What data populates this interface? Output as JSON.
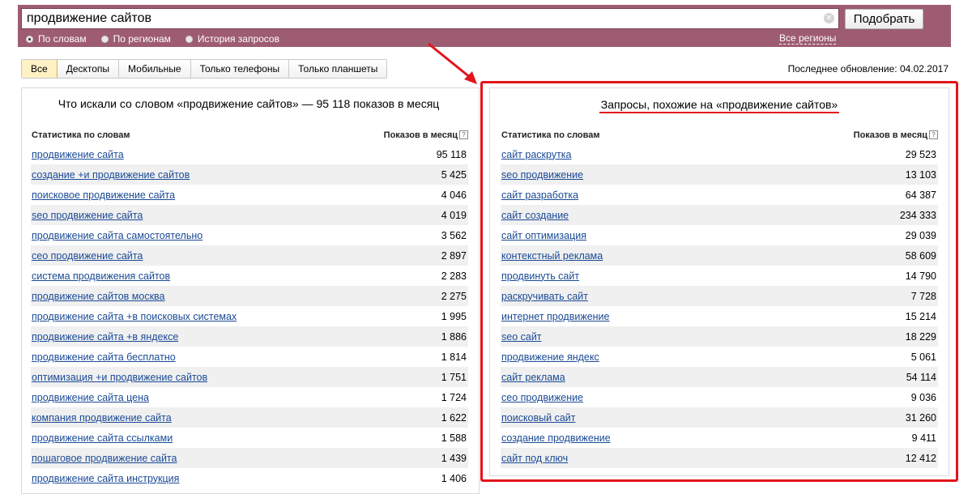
{
  "search": {
    "query": "продвижение сайтов",
    "button_label": "Подобрать",
    "modes": [
      {
        "label": "По словам",
        "selected": true
      },
      {
        "label": "По регионам",
        "selected": false
      },
      {
        "label": "История запросов",
        "selected": false
      }
    ],
    "regions_link": "Все регионы"
  },
  "device_tabs": [
    {
      "label": "Все",
      "active": true
    },
    {
      "label": "Десктопы",
      "active": false
    },
    {
      "label": "Мобильные",
      "active": false
    },
    {
      "label": "Только телефоны",
      "active": false
    },
    {
      "label": "Только планшеты",
      "active": false
    }
  ],
  "last_update": "Последнее обновление: 04.02.2017",
  "left_panel": {
    "title": "Что искали со словом «продвижение сайтов» — 95 118 показов в месяц",
    "col_words": "Статистика по словам",
    "col_count": "Показов в месяц",
    "rows": [
      {
        "phrase": "продвижение сайта",
        "count": "95 118"
      },
      {
        "phrase": "создание +и продвижение сайтов",
        "count": "5 425"
      },
      {
        "phrase": "поисковое продвижение сайта",
        "count": "4 046"
      },
      {
        "phrase": "seo продвижение сайта",
        "count": "4 019"
      },
      {
        "phrase": "продвижение сайта самостоятельно",
        "count": "3 562"
      },
      {
        "phrase": "сео продвижение сайта",
        "count": "2 897"
      },
      {
        "phrase": "система продвижения сайтов",
        "count": "2 283"
      },
      {
        "phrase": "продвижение сайтов москва",
        "count": "2 275"
      },
      {
        "phrase": "продвижение сайта +в поисковых системах",
        "count": "1 995"
      },
      {
        "phrase": "продвижение сайта +в яндексе",
        "count": "1 886"
      },
      {
        "phrase": "продвижение сайта бесплатно",
        "count": "1 814"
      },
      {
        "phrase": "оптимизация +и продвижение сайтов",
        "count": "1 751"
      },
      {
        "phrase": "продвижение сайта цена",
        "count": "1 724"
      },
      {
        "phrase": "компания продвижение сайта",
        "count": "1 622"
      },
      {
        "phrase": "продвижение сайта ссылками",
        "count": "1 588"
      },
      {
        "phrase": "пошаговое продвижение сайта",
        "count": "1 439"
      },
      {
        "phrase": "продвижение сайта инструкция",
        "count": "1 406"
      }
    ]
  },
  "right_panel": {
    "title": "Запросы, похожие на «продвижение сайтов»",
    "col_words": "Статистика по словам",
    "col_count": "Показов в месяц",
    "rows": [
      {
        "phrase": "сайт раскрутка",
        "count": "29 523"
      },
      {
        "phrase": "seo продвижение",
        "count": "13 103"
      },
      {
        "phrase": "сайт разработка",
        "count": "64 387"
      },
      {
        "phrase": "сайт создание",
        "count": "234 333"
      },
      {
        "phrase": "сайт оптимизация",
        "count": "29 039"
      },
      {
        "phrase": "контекстный реклама",
        "count": "58 609"
      },
      {
        "phrase": "продвинуть сайт",
        "count": "14 790"
      },
      {
        "phrase": "раскручивать сайт",
        "count": "7 728"
      },
      {
        "phrase": "интернет продвижение",
        "count": "15 214"
      },
      {
        "phrase": "seo сайт",
        "count": "18 229"
      },
      {
        "phrase": "продвижение яндекс",
        "count": "5 061"
      },
      {
        "phrase": "сайт реклама",
        "count": "54 114"
      },
      {
        "phrase": "сео продвижение",
        "count": "9 036"
      },
      {
        "phrase": "поисковый сайт",
        "count": "31 260"
      },
      {
        "phrase": "создание продвижение",
        "count": "9 411"
      },
      {
        "phrase": "сайт под ключ",
        "count": "12 412"
      }
    ]
  },
  "colors": {
    "band": "#9e5c72",
    "highlight": "#e3141b",
    "link": "#1a4a96"
  }
}
